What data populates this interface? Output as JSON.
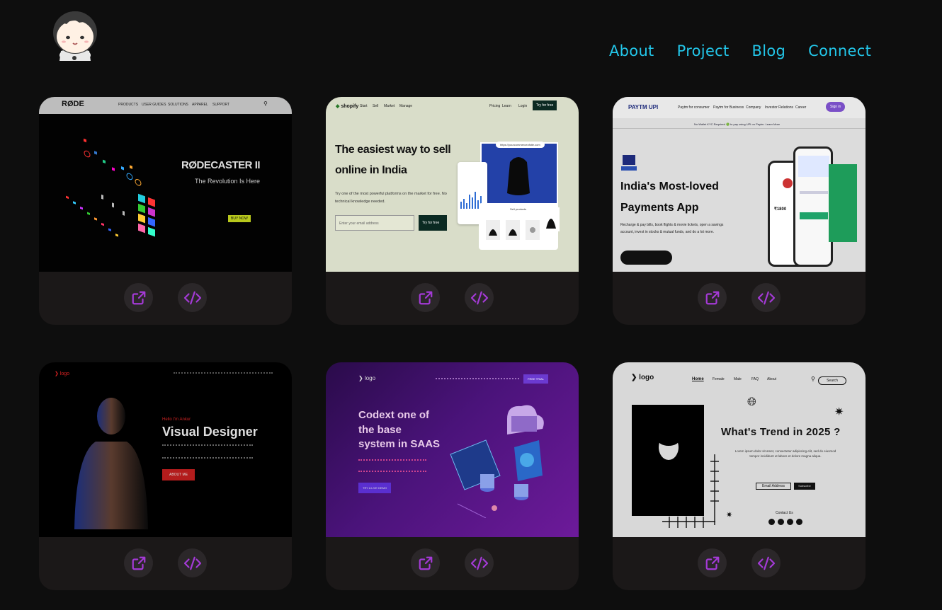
{
  "nav": {
    "about": "About",
    "project": "Project",
    "blog": "Blog",
    "connect": "Connect"
  },
  "colors": {
    "accent": "#23c7ea",
    "icon": "#a43ad6",
    "card": "#1b1818",
    "button": "#2b2729"
  },
  "projects": [
    {
      "name": "rode",
      "nav": [
        "PRODUCTS",
        "USER GUIDES",
        "SOLUTIONS",
        "APPAREL",
        "SUPPORT"
      ],
      "logo": "RØDE",
      "hero1": "RØDECASTER",
      "hero1b": "II",
      "hero2": "The Revolution Is Here",
      "cta": "BUY NOW"
    },
    {
      "name": "shopify",
      "logo": "shopify",
      "nav": [
        "Start",
        "Sell",
        "Market",
        "Manage"
      ],
      "navr": [
        "Pricing",
        "Learn",
        "Login"
      ],
      "cta": "Try for free",
      "h1": "The easiest way to sell",
      "h2": "online in India",
      "p": "Try one of the most powerful platforms on the market for free. No technical knowledge needed.",
      "input": "Enter your email address",
      "btn": "Try for free",
      "url": "https://yourcommerceofsite.com",
      "sell": "Sell products"
    },
    {
      "name": "paytm",
      "logo": "PAYTM UPI",
      "nav": [
        "Paytm for consumer",
        "Paytm for Business",
        "Company",
        "Investor Relations",
        "Career"
      ],
      "signin": "Sign in",
      "banner": "No Wallet KYC Required 🟢 to pay using UPI on Paytm. Learn More",
      "h1": "India's Most-loved",
      "h2": "Payments App",
      "p1": "Recharge & pay bills, book flights & movie tickets, open a savings",
      "p2": "account, invest in stocks & mutual funds, and do a lot more.",
      "balance": "₹1800"
    },
    {
      "name": "designer",
      "logo": "logo",
      "hello": "Hello I'm Ankur",
      "title": "Visual Designer",
      "cta": "ABOUT ME"
    },
    {
      "name": "saas",
      "logo": "logo",
      "h1": "Codext one of",
      "h2": "the base",
      "h3": "system in SAAS",
      "cta": "TRY A LIVE DEMO",
      "nav_cta": "FREE TRIAL"
    },
    {
      "name": "trend",
      "logo": "logo",
      "nav": [
        "Home",
        "Female",
        "Male",
        "FAQ",
        "About"
      ],
      "search": "Search",
      "h1": "What's Trend in 2025 ?",
      "p": "Lorem ipsum dolor sit amet, consectetur adipiscing elit, sed do eiusmod tempor incididunt ut labore et dolore magna aliqua.",
      "email": "Email Address",
      "subscribe": "Subscribe",
      "contact": "Contact Us"
    }
  ],
  "icons": {
    "live": "external-link-icon",
    "code": "code-icon"
  }
}
